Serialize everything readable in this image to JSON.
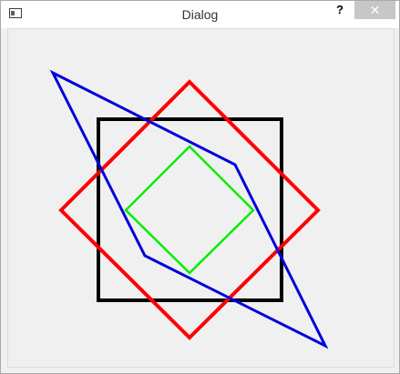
{
  "window": {
    "title": "Dialog",
    "help_label": "?",
    "close_label": "✕"
  },
  "icons": {
    "app": "window-app-icon",
    "help": "help-icon",
    "close": "close-icon"
  },
  "shapes": {
    "square_color": "#000000",
    "red_diamond_color": "#ff0000",
    "green_diamond_color": "#00ee00",
    "blue_polygon_color": "#0000dd"
  }
}
